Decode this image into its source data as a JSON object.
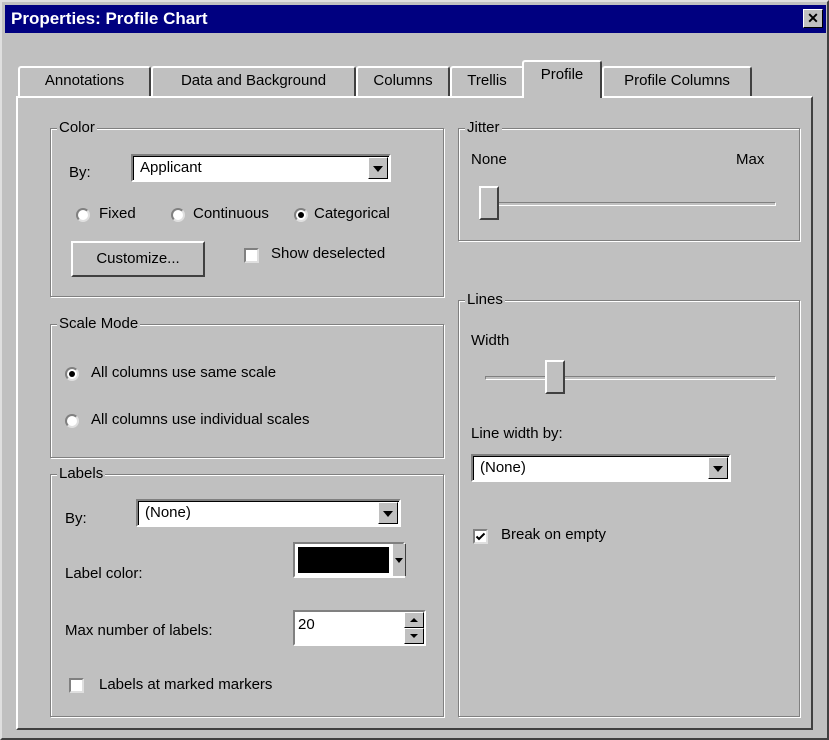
{
  "window": {
    "title": "Properties: Profile Chart",
    "close_glyph": "✕"
  },
  "tabs": [
    {
      "label": "Annotations"
    },
    {
      "label": "Data and Background"
    },
    {
      "label": "Columns"
    },
    {
      "label": "Trellis"
    },
    {
      "label": "Profile",
      "active": true
    },
    {
      "label": "Profile Columns"
    }
  ],
  "color": {
    "legend": "Color",
    "by_label": "By:",
    "by_value": "Applicant",
    "radios": [
      {
        "label": "Fixed",
        "selected": false
      },
      {
        "label": "Continuous",
        "selected": false
      },
      {
        "label": "Categorical",
        "selected": true
      }
    ],
    "customize_label": "Customize...",
    "show_deselected_label": "Show deselected",
    "show_deselected_checked": false
  },
  "scale_mode": {
    "legend": "Scale Mode",
    "options": [
      {
        "label": "All columns use same scale",
        "selected": true
      },
      {
        "label": "All columns use individual scales",
        "selected": false
      }
    ]
  },
  "labels": {
    "legend": "Labels",
    "by_label": "By:",
    "by_value": "(None)",
    "label_color_label": "Label color:",
    "label_color_value": "#000000",
    "max_labels_label": "Max number of labels:",
    "max_labels_value": "20",
    "marked_markers_label": "Labels at marked markers",
    "marked_markers_checked": false
  },
  "jitter": {
    "legend": "Jitter",
    "min_label": "None",
    "max_label": "Max",
    "level": 0.0
  },
  "lines": {
    "legend": "Lines",
    "width_label": "Width",
    "width_level": 0.24,
    "line_width_by_label": "Line width by:",
    "line_width_by_value": "(None)",
    "break_on_empty_label": "Break on empty",
    "break_on_empty_checked": true
  }
}
